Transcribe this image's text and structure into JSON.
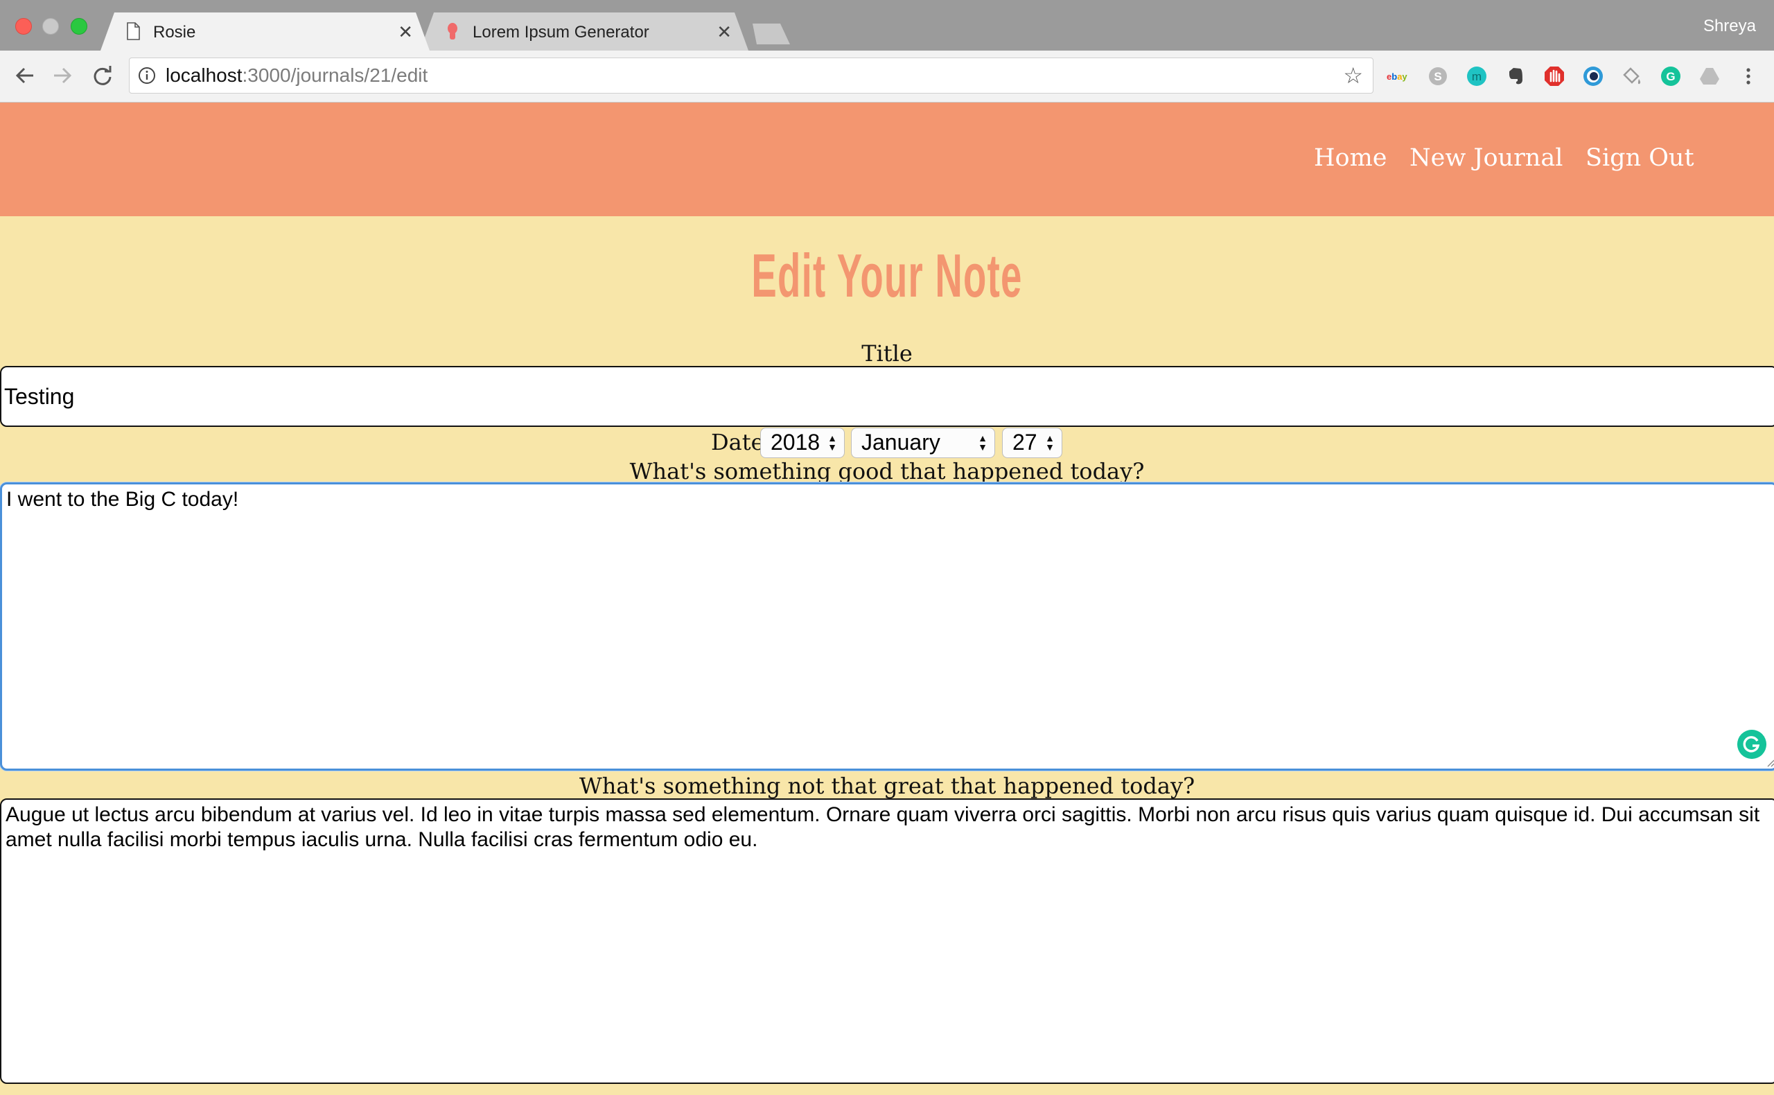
{
  "browser": {
    "tabs": [
      {
        "title": "Rosie",
        "icon": "document-icon",
        "active": true
      },
      {
        "title": "Lorem Ipsum Generator",
        "icon": "lorem-favicon-icon",
        "active": false
      }
    ],
    "profile_name": "Shreya",
    "url_host": "localhost",
    "url_rest": ":3000/journals/21/edit",
    "extensions": [
      "ebay-icon",
      "skype-icon",
      "m-extension-icon",
      "evernote-icon",
      "adblock-icon",
      "eye-extension-icon",
      "paint-bucket-icon",
      "grammarly-icon",
      "drive-icon"
    ]
  },
  "colors": {
    "header": "#f39670",
    "page_bg": "#f8e6a9",
    "accent": "#f39670"
  },
  "nav": {
    "home": "Home",
    "new_journal": "New Journal",
    "sign_out": "Sign Out"
  },
  "heading": "Edit Your Note",
  "form": {
    "title_label": "Title",
    "title_value": "Testing",
    "date_label": "Date",
    "year": "2018",
    "month": "January",
    "day": "27",
    "good_label": "What's something good that happened today?",
    "good_value": "I went to the Big C today!",
    "bad_label": "What's something not that great that happened today?",
    "bad_value": "Augue ut lectus arcu bibendum at varius vel. Id leo in vitae turpis massa sed elementum. Ornare quam viverra orci sagittis. Morbi non arcu risus quis varius quam quisque id. Dui accumsan sit amet nulla facilisi morbi tempus iaculis urna. Nulla facilisi cras fermentum odio eu."
  }
}
